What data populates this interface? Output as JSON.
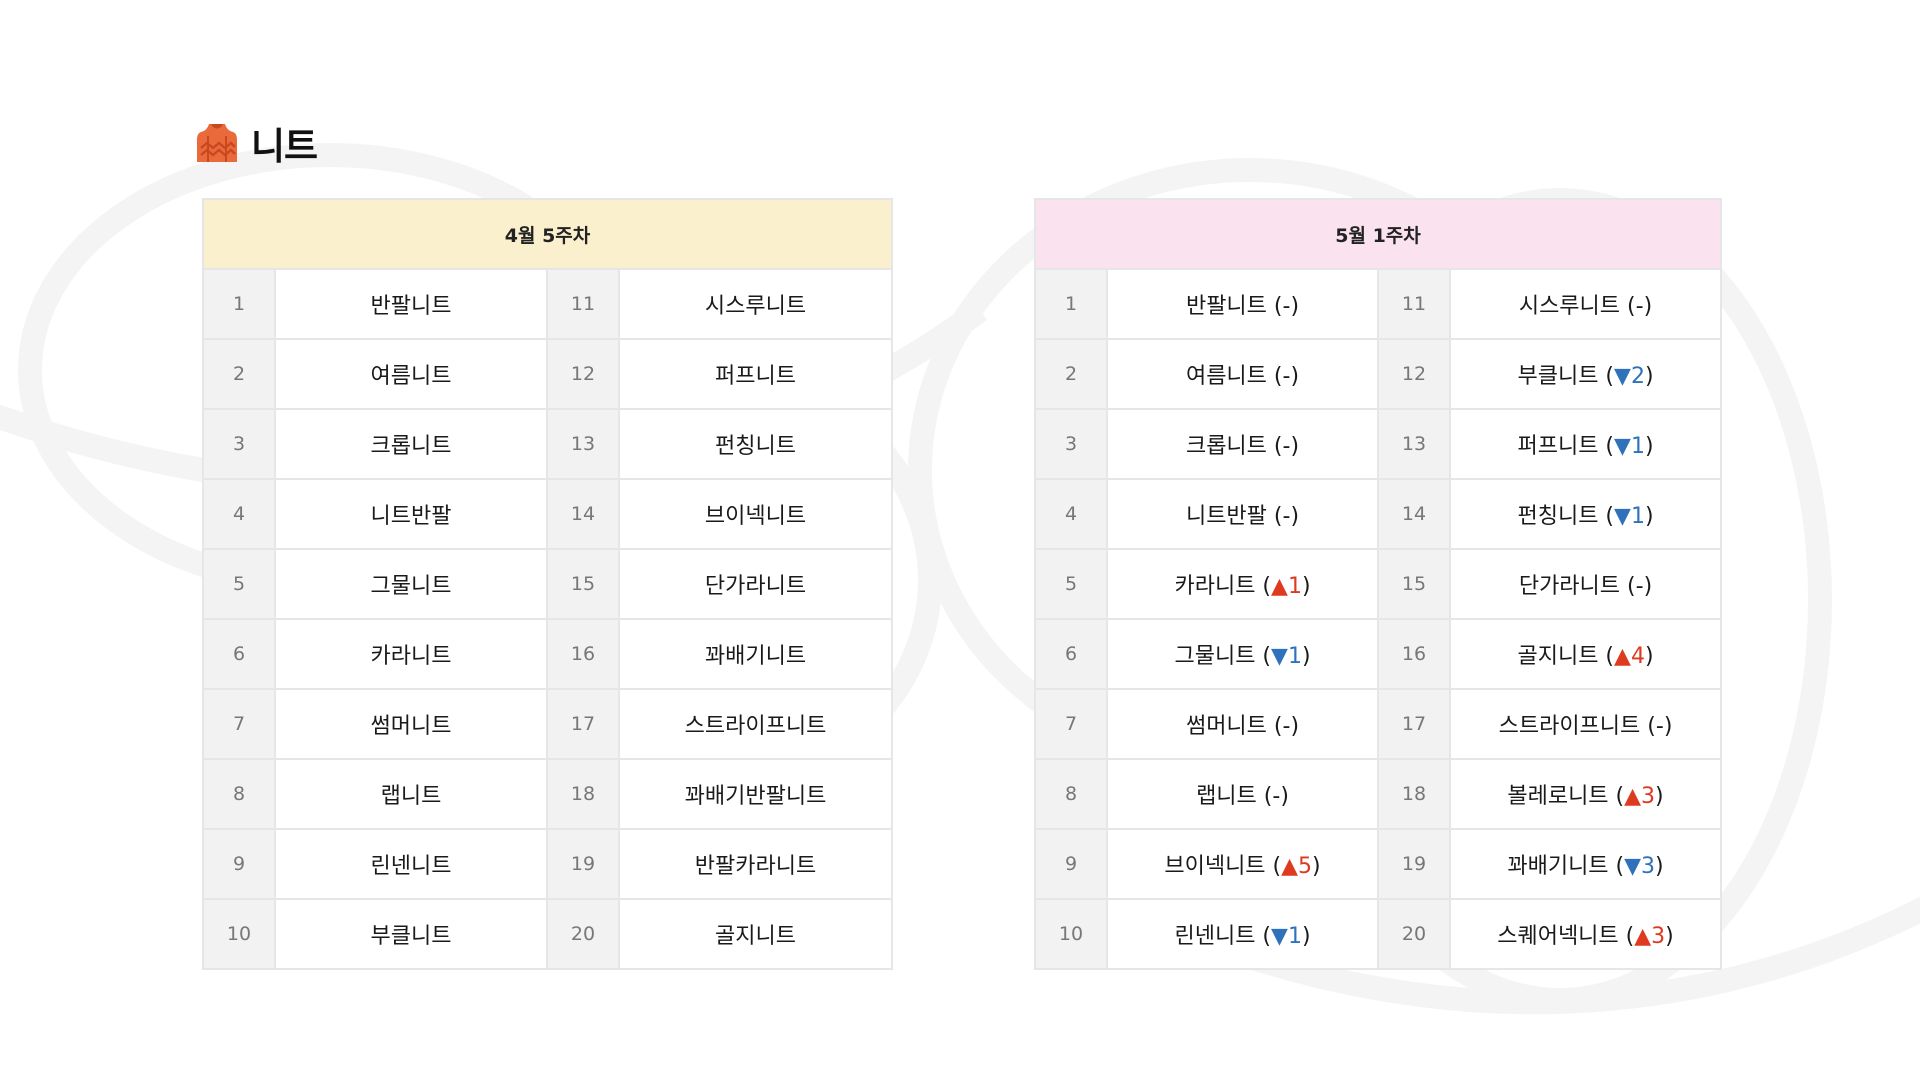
{
  "title": "니트",
  "icon": "sweater-icon",
  "colors": {
    "up": "#de3a1f",
    "down": "#2f72bb",
    "left_header_bg": "#fbf0cd",
    "right_header_bg": "#fae3ee",
    "icon": "#ea6a3c"
  },
  "weeks": [
    {
      "header": "4월 5주차",
      "rows": [
        {
          "rank": "1",
          "name": "반팔니트"
        },
        {
          "rank": "2",
          "name": "여름니트"
        },
        {
          "rank": "3",
          "name": "크롭니트"
        },
        {
          "rank": "4",
          "name": "니트반팔"
        },
        {
          "rank": "5",
          "name": "그물니트"
        },
        {
          "rank": "6",
          "name": "카라니트"
        },
        {
          "rank": "7",
          "name": "썸머니트"
        },
        {
          "rank": "8",
          "name": "랩니트"
        },
        {
          "rank": "9",
          "name": "린넨니트"
        },
        {
          "rank": "10",
          "name": "부클니트"
        },
        {
          "rank": "11",
          "name": "시스루니트"
        },
        {
          "rank": "12",
          "name": "퍼프니트"
        },
        {
          "rank": "13",
          "name": "펀칭니트"
        },
        {
          "rank": "14",
          "name": "브이넥니트"
        },
        {
          "rank": "15",
          "name": "단가라니트"
        },
        {
          "rank": "16",
          "name": "꽈배기니트"
        },
        {
          "rank": "17",
          "name": "스트라이프니트"
        },
        {
          "rank": "18",
          "name": "꽈배기반팔니트"
        },
        {
          "rank": "19",
          "name": "반팔카라니트"
        },
        {
          "rank": "20",
          "name": "골지니트"
        }
      ]
    },
    {
      "header": "5월 1주차",
      "rows": [
        {
          "rank": "1",
          "name": "반팔니트",
          "change": "same",
          "change_value": "-"
        },
        {
          "rank": "2",
          "name": "여름니트",
          "change": "same",
          "change_value": "-"
        },
        {
          "rank": "3",
          "name": "크롭니트",
          "change": "same",
          "change_value": "-"
        },
        {
          "rank": "4",
          "name": "니트반팔",
          "change": "same",
          "change_value": "-"
        },
        {
          "rank": "5",
          "name": "카라니트",
          "change": "up",
          "change_value": "1"
        },
        {
          "rank": "6",
          "name": "그물니트",
          "change": "down",
          "change_value": "1"
        },
        {
          "rank": "7",
          "name": "썸머니트",
          "change": "same",
          "change_value": "-"
        },
        {
          "rank": "8",
          "name": "랩니트",
          "change": "same",
          "change_value": "-"
        },
        {
          "rank": "9",
          "name": "브이넥니트",
          "change": "up",
          "change_value": "5"
        },
        {
          "rank": "10",
          "name": "린넨니트",
          "change": "down",
          "change_value": "1"
        },
        {
          "rank": "11",
          "name": "시스루니트",
          "change": "same",
          "change_value": "-"
        },
        {
          "rank": "12",
          "name": "부클니트",
          "change": "down",
          "change_value": "2"
        },
        {
          "rank": "13",
          "name": "퍼프니트",
          "change": "down",
          "change_value": "1"
        },
        {
          "rank": "14",
          "name": "펀칭니트",
          "change": "down",
          "change_value": "1"
        },
        {
          "rank": "15",
          "name": "단가라니트",
          "change": "same",
          "change_value": "-"
        },
        {
          "rank": "16",
          "name": "골지니트",
          "change": "up",
          "change_value": "4"
        },
        {
          "rank": "17",
          "name": "스트라이프니트",
          "change": "same",
          "change_value": "-"
        },
        {
          "rank": "18",
          "name": "볼레로니트",
          "change": "up",
          "change_value": "3"
        },
        {
          "rank": "19",
          "name": "꽈배기니트",
          "change": "down",
          "change_value": "3"
        },
        {
          "rank": "20",
          "name": "스퀘어넥니트",
          "change": "up",
          "change_value": "3"
        }
      ]
    }
  ]
}
